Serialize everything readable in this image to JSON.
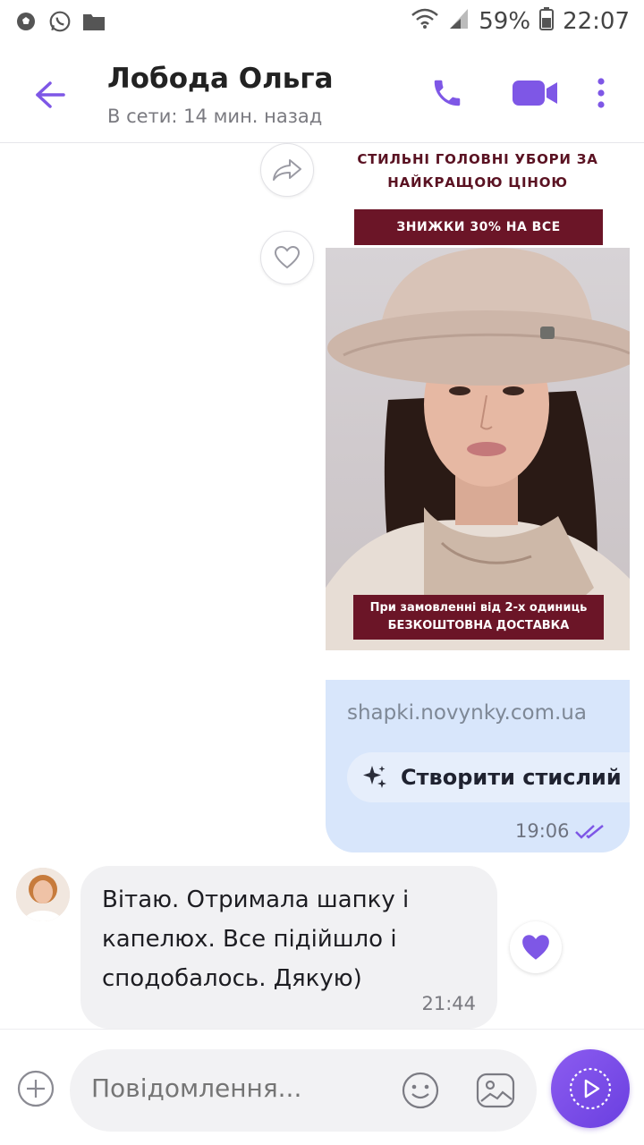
{
  "status": {
    "battery": "59%",
    "time": "22:07"
  },
  "header": {
    "title": "Лобода Ольга",
    "subtitle": "В сети: 14 мин. назад"
  },
  "promo": {
    "title": "СТИЛЬНІ ГОЛОВНІ УБОРИ ЗА НАЙКРАЩОЮ ЦІНОЮ",
    "badge": "ЗНИЖКИ 30% НА ВСЕ",
    "bottom_line1": "При замовленні від 2-х одиниць",
    "bottom_line2": "БЕЗКОШТОВНА ДОСТАВКА"
  },
  "outgoing": {
    "link": "shapki.novynky.com.ua",
    "ai_button": "Створити стислий ви",
    "time": "19:06"
  },
  "incoming": {
    "text": "Вітаю. Отримала  шапку і капелюх. Все підійшло і сподобалось. Дякую)",
    "time": "21:44"
  },
  "composer": {
    "placeholder": "Повідомлення..."
  },
  "colors": {
    "accent": "#7e57e6",
    "out_bubble": "#d8e6fb",
    "in_bubble": "#f1f1f3",
    "promo_red": "#6b1527"
  }
}
